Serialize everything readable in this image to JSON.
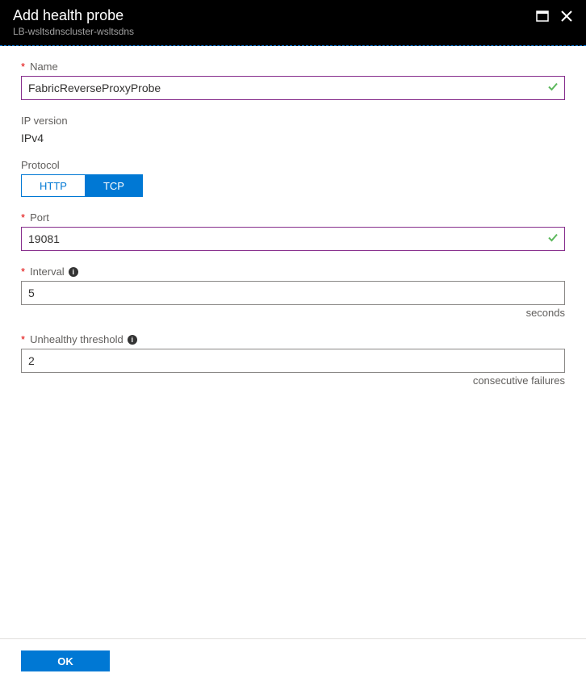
{
  "header": {
    "title": "Add health probe",
    "subtitle": "LB-wsltsdnscluster-wsltsdns"
  },
  "fields": {
    "name": {
      "label": "Name",
      "value": "FabricReverseProxyProbe"
    },
    "ipversion": {
      "label": "IP version",
      "value": "IPv4"
    },
    "protocol": {
      "label": "Protocol",
      "options": {
        "http": "HTTP",
        "tcp": "TCP"
      }
    },
    "port": {
      "label": "Port",
      "value": "19081"
    },
    "interval": {
      "label": "Interval",
      "value": "5",
      "hint": "seconds"
    },
    "threshold": {
      "label": "Unhealthy threshold",
      "value": "2",
      "hint": "consecutive failures"
    }
  },
  "footer": {
    "ok": "OK"
  }
}
